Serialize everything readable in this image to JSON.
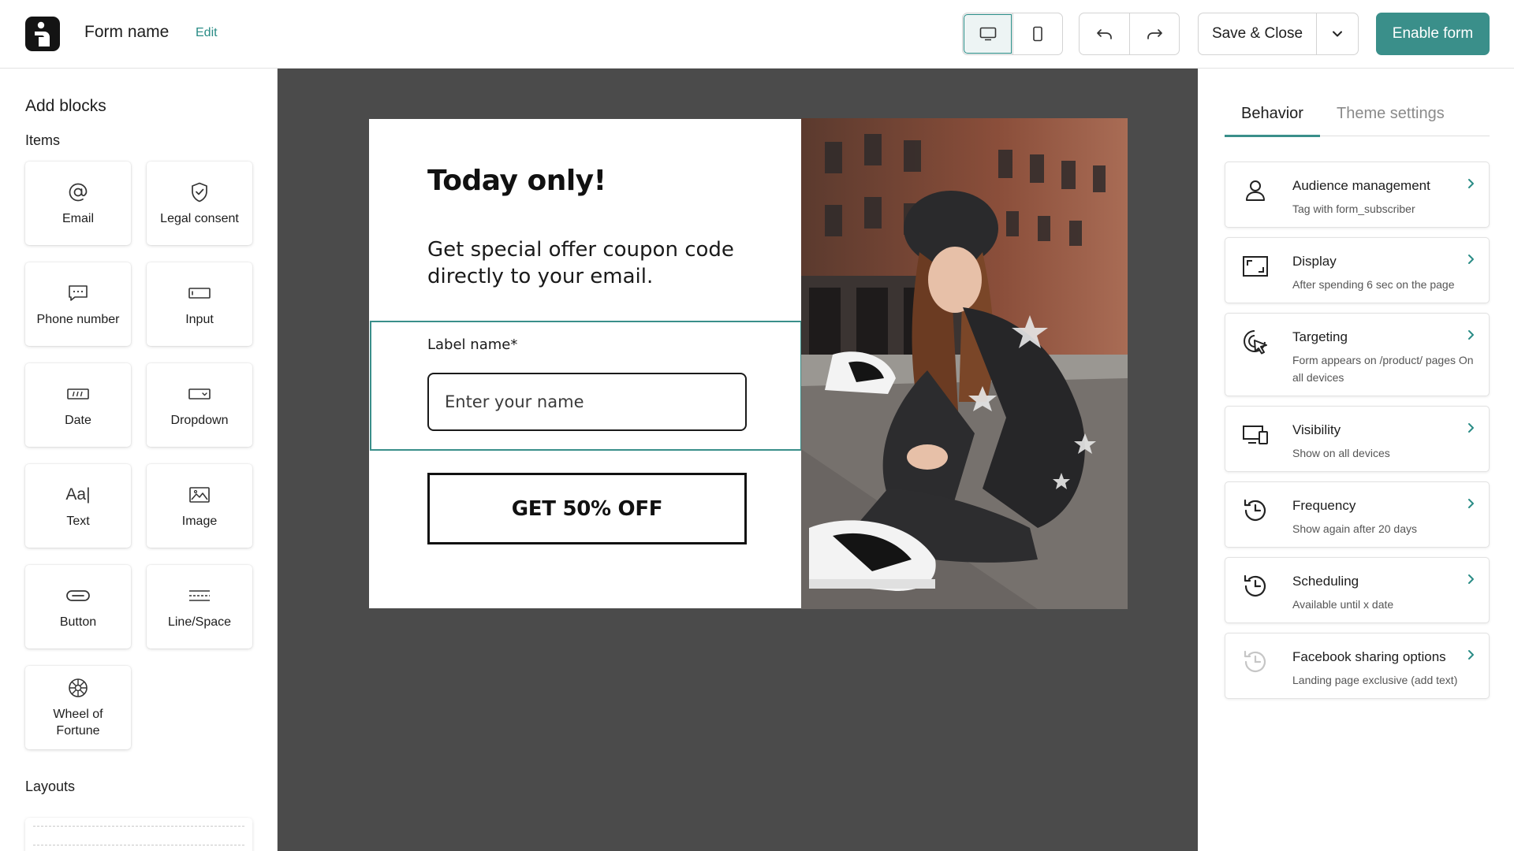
{
  "header": {
    "form_name": "Form name",
    "edit_label": "Edit",
    "save_close_label": "Save & Close",
    "enable_label": "Enable form"
  },
  "sidebar": {
    "title": "Add blocks",
    "items_heading": "Items",
    "blocks": [
      {
        "label": "Email",
        "icon": "at-icon"
      },
      {
        "label": "Legal consent",
        "icon": "shield-check-icon"
      },
      {
        "label": "Phone number",
        "icon": "chat-bubble-icon"
      },
      {
        "label": "Input",
        "icon": "input-field-icon"
      },
      {
        "label": "Date",
        "icon": "date-field-icon"
      },
      {
        "label": "Dropdown",
        "icon": "dropdown-icon"
      },
      {
        "label": "Text",
        "icon": "text-icon",
        "glyph": "Aa|"
      },
      {
        "label": "Image",
        "icon": "image-icon"
      },
      {
        "label": "Button",
        "icon": "button-icon"
      },
      {
        "label": "Line/Space",
        "icon": "line-space-icon"
      },
      {
        "label": "Wheel of Fortune",
        "icon": "wheel-icon"
      }
    ],
    "layouts_heading": "Layouts"
  },
  "form_preview": {
    "headline": "Today only!",
    "subtext": "Get special offer coupon code directly to your email.",
    "field_label": "Label name*",
    "field_placeholder": "Enter your name",
    "cta_label": "GET 50% OFF"
  },
  "panel": {
    "tabs": [
      "Behavior",
      "Theme settings"
    ],
    "active_tab": "Behavior",
    "settings": [
      {
        "title": "Audience management",
        "description": "Tag with form_subscriber",
        "icon": "user-icon"
      },
      {
        "title": "Display",
        "description": "After spending 6 sec on the page",
        "icon": "display-frame-icon"
      },
      {
        "title": "Targeting",
        "description": "Form appears on /product/ pages On all devices",
        "icon": "target-cursor-icon"
      },
      {
        "title": "Visibility",
        "description": "Show on all devices",
        "icon": "devices-icon"
      },
      {
        "title": "Frequency",
        "description": "Show again after 20 days",
        "icon": "clock-history-icon"
      },
      {
        "title": "Scheduling",
        "description": "Available until x date",
        "icon": "clock-history-icon"
      },
      {
        "title": "Facebook sharing options",
        "description": "Landing page exclusive (add text)",
        "icon": "clock-history-disabled-icon"
      }
    ]
  },
  "colors": {
    "accent": "#3a8f8a",
    "canvas_bg": "#4b4b4b",
    "text": "#1d1d1d"
  }
}
